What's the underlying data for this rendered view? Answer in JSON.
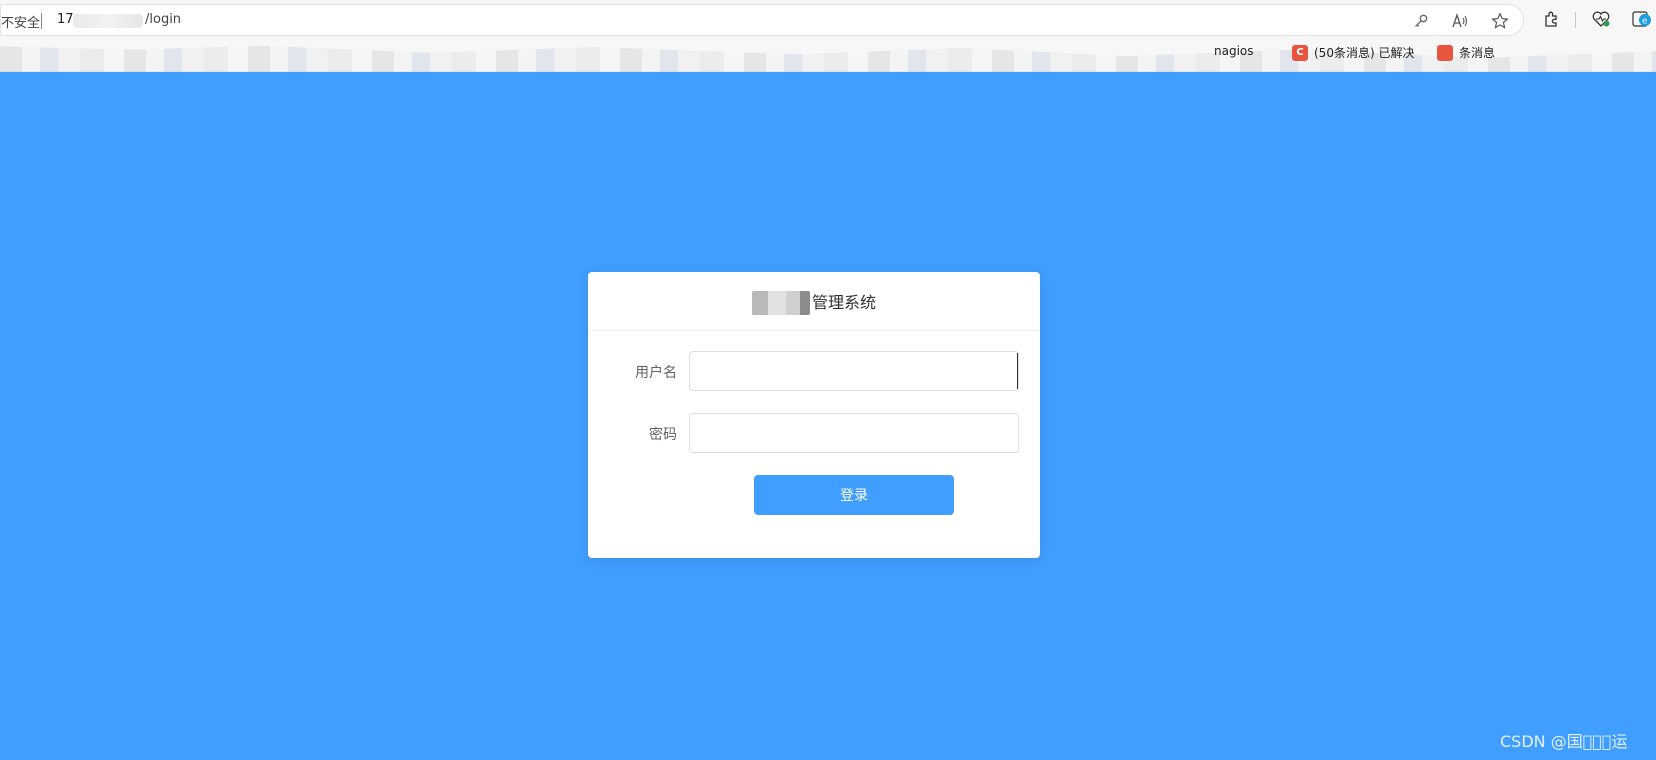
{
  "browser": {
    "security_text": "不安全",
    "url_prefix": "17",
    "url_path": "/login",
    "toolbar_icons": [
      "key-icon",
      "read-aloud-icon",
      "favorite-star-icon",
      "extensions-icon",
      "browser-essentials-icon",
      "edge-icon"
    ],
    "bookmarks": [
      {
        "label": "nagios",
        "favicon_color": "#f2f2f2",
        "favicon_text": ""
      },
      {
        "label": "(50条消息) 已解决",
        "favicon_color": "#e8553e",
        "favicon_text": "C"
      },
      {
        "label": "条消息",
        "favicon_color": "#e8553e",
        "favicon_text": ""
      }
    ]
  },
  "login": {
    "title_suffix": "管理系统",
    "username_label": "用户名",
    "username_value": "",
    "password_label": "密码",
    "password_value": "",
    "submit_label": "登录"
  },
  "watermark": "CSDN @国\u0000\u0000\u0000运",
  "colors": {
    "background": "#409eff",
    "card": "#ffffff",
    "primary": "#409eff"
  }
}
